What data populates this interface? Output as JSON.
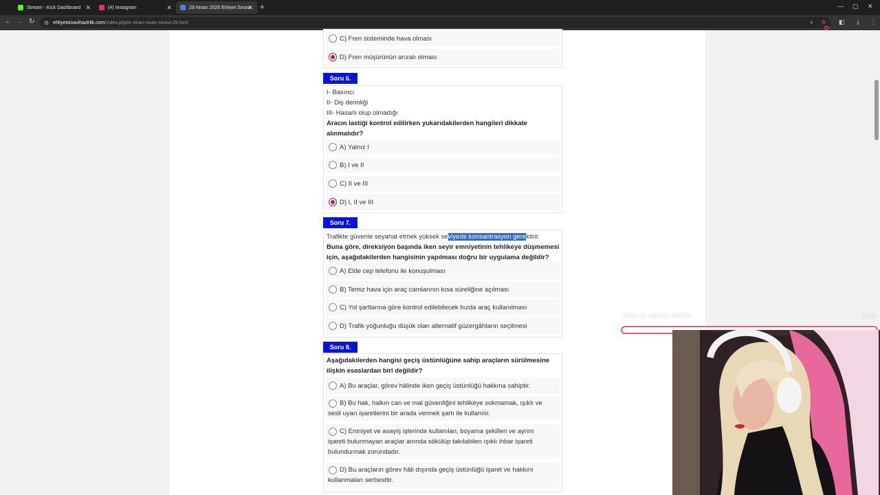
{
  "browser": {
    "tabs": [
      {
        "label": "Stream - Kick Dashboard",
        "color": "#53fc18"
      },
      {
        "label": "(4) Instagram",
        "color": "#e1306c"
      },
      {
        "label": "29 Nisan 2026 Ehliyet Sınavı Ha",
        "color": "#5a7dd8"
      }
    ],
    "url_domain": "ehliyetsinavihazirlik.com",
    "url_path": "/index.php/e-sinav-nisan-sinavi-29.html"
  },
  "q5_partial": {
    "options": [
      {
        "label": "C) Fren sisteminde hava olması",
        "checked": false
      },
      {
        "label": "D) Fren müşürünün arızalı olması",
        "checked": true
      }
    ]
  },
  "q6": {
    "badge": "Soru 6.",
    "premises": [
      "I- Basıncı",
      "II- Diş derinliği",
      "III- Hasarlı olup olmadığı"
    ],
    "question_l1": "Aracın lastiği kontrol edilirken yukarıdakilerden hangileri dikkate",
    "question_l2": "alınmalıdır?",
    "options": [
      {
        "label": "A) Yalnız I",
        "checked": false
      },
      {
        "label": "B) I ve II",
        "checked": false
      },
      {
        "label": "C) II ve III",
        "checked": false
      },
      {
        "label": "D) I, II ve III",
        "checked": true
      }
    ]
  },
  "q7": {
    "badge": "Soru 7.",
    "intro_a": "Trafikte güvenle seyahat etmek yüksek se",
    "intro_sel": "viyede konsantrasyon gere",
    "intro_b": "ktirir.",
    "question_l1": "Buna göre, direksiyon başında iken seyir emniyetinin tehlikeye düşmemesi",
    "question_l2": "için, aşağıdakilerden hangisinin yapılması doğru bir uygulama değildir?",
    "options": [
      {
        "label": "A) Elde cep telefonu ile konuşulması",
        "checked": false
      },
      {
        "label": "B) Temiz hava için araç camlarının kısa süreliğine açılması",
        "checked": false
      },
      {
        "label": "C) Yol şartlarına göre kontrol edilebilecek hızda araç kullanılması",
        "checked": false
      },
      {
        "label": "D) Trafik yoğunluğu düşük olan alternatif güzergâhların seçilmesi",
        "checked": false
      }
    ]
  },
  "q8": {
    "badge": "Soru 8.",
    "question_l1": "Aşağıdakilerden hangisi geçiş üstünlüğüne sahip araçların sürülmesine",
    "question_l2": "ilişkin esaslardan biri değildir?",
    "options": [
      {
        "lines": [
          "A) Bu araçlar, görev hâlinde iken geçiş üstünlüğü hakkına sahiptir."
        ],
        "checked": false
      },
      {
        "lines": [
          "B) Bu hak, halkın can ve mal güvenliğini tehlikeye sokmamak, ışıklı ve",
          "sesli uyarı işaretlerini bir arada vermek şartı ile kullanılır."
        ],
        "checked": false
      },
      {
        "lines": [
          "C) Emniyet ve asayiş işlerinde kullanılan, boyama şekilleri ve ayrım",
          "işareti bulunmayan araçlar anında sökülüp takılabilen ışıklı ihbar işareti",
          "bulundurmak zorundadır."
        ],
        "checked": false
      },
      {
        "lines": [
          "D) Bu araçların görev hâli dışında geçiş üstünlüğü işaret ve hakkını",
          "kullanmaları serbesttir."
        ],
        "checked": false
      }
    ]
  },
  "overlay": {
    "goal_label": "GÜNLÜK ABONE HEDEFİ",
    "goal_count": "0 / 25",
    "accent": "#e0607e"
  },
  "colors": {
    "badge": "#0a14d8",
    "selected_radio": "#c2185b",
    "selection_highlight": "#2a6fd6"
  }
}
